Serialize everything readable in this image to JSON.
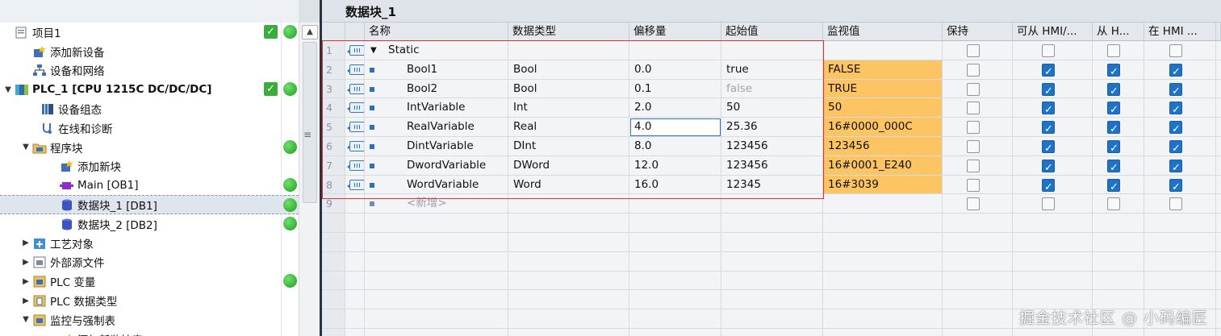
{
  "tree": {
    "items": [
      {
        "label": "项目1",
        "indent": 0,
        "arrow": "",
        "icon": "project-icon",
        "status_check": true,
        "status_dot": true,
        "bold": false,
        "selected": false
      },
      {
        "label": "添加新设备",
        "indent": 1,
        "arrow": "",
        "icon": "add-device-icon",
        "status_check": false,
        "status_dot": false,
        "bold": false,
        "selected": false
      },
      {
        "label": "设备和网络",
        "indent": 1,
        "arrow": "",
        "icon": "network-icon",
        "status_check": false,
        "status_dot": false,
        "bold": false,
        "selected": false
      },
      {
        "label": "PLC_1 [CPU 1215C DC/DC/DC]",
        "indent": 0,
        "arrow": "▼",
        "icon": "plc-icon",
        "status_check": true,
        "status_dot": true,
        "bold": true,
        "selected": false
      },
      {
        "label": "设备组态",
        "indent": 2,
        "arrow": "",
        "icon": "device-config-icon",
        "status_check": false,
        "status_dot": false,
        "bold": false,
        "selected": false
      },
      {
        "label": "在线和诊断",
        "indent": 2,
        "arrow": "",
        "icon": "diagnostics-icon",
        "status_check": false,
        "status_dot": false,
        "bold": false,
        "selected": false
      },
      {
        "label": "程序块",
        "indent": 1,
        "arrow": "▼",
        "icon": "folder-icon",
        "status_check": false,
        "status_dot": true,
        "bold": false,
        "selected": false
      },
      {
        "label": "添加新块",
        "indent": 3,
        "arrow": "",
        "icon": "add-block-icon",
        "status_check": false,
        "status_dot": false,
        "bold": false,
        "selected": false
      },
      {
        "label": "Main [OB1]",
        "indent": 3,
        "arrow": "",
        "icon": "ob-block-icon",
        "status_check": false,
        "status_dot": true,
        "bold": false,
        "selected": false
      },
      {
        "label": "数据块_1 [DB1]",
        "indent": 3,
        "arrow": "",
        "icon": "db-block-icon",
        "status_check": false,
        "status_dot": true,
        "bold": false,
        "selected": true
      },
      {
        "label": "数据块_2 [DB2]",
        "indent": 3,
        "arrow": "",
        "icon": "db-block-icon",
        "status_check": false,
        "status_dot": true,
        "bold": false,
        "selected": false
      },
      {
        "label": "工艺对象",
        "indent": 1,
        "arrow": "▶",
        "icon": "technology-object-icon",
        "status_check": false,
        "status_dot": false,
        "bold": false,
        "selected": false
      },
      {
        "label": "外部源文件",
        "indent": 1,
        "arrow": "▶",
        "icon": "external-source-icon",
        "status_check": false,
        "status_dot": false,
        "bold": false,
        "selected": false
      },
      {
        "label": "PLC 变量",
        "indent": 1,
        "arrow": "▶",
        "icon": "plc-tags-icon",
        "status_check": false,
        "status_dot": true,
        "bold": false,
        "selected": false
      },
      {
        "label": "PLC 数据类型",
        "indent": 1,
        "arrow": "▶",
        "icon": "plc-datatype-icon",
        "status_check": false,
        "status_dot": false,
        "bold": false,
        "selected": false
      },
      {
        "label": "监控与强制表",
        "indent": 1,
        "arrow": "▼",
        "icon": "watch-table-icon",
        "status_check": false,
        "status_dot": false,
        "bold": false,
        "selected": false
      },
      {
        "label": "添加新监控表",
        "indent": 3,
        "arrow": "",
        "icon": "add-watch-table-icon",
        "status_check": false,
        "status_dot": false,
        "bold": false,
        "selected": false
      }
    ]
  },
  "editor": {
    "title": "数据块_1",
    "columns": {
      "name": "名称",
      "datatype": "数据类型",
      "offset": "偏移量",
      "start": "起始值",
      "monitor": "监视值",
      "retain": "保持",
      "hmi_access": "可从 HMI/...",
      "hmi_write": "从 H...",
      "hmi_visible": "在 HMI ..."
    },
    "rows": [
      {
        "num": "1",
        "name": "Static",
        "type": "",
        "offset": "",
        "start": "",
        "monitor": "",
        "is_group": true,
        "retain": false,
        "hmi_access": false,
        "hmi_write": false,
        "hmi_visible": false
      },
      {
        "num": "2",
        "name": "Bool1",
        "type": "Bool",
        "offset": "0.0",
        "start": "true",
        "monitor": "FALSE",
        "is_group": false,
        "retain": false,
        "hmi_access": true,
        "hmi_write": true,
        "hmi_visible": true
      },
      {
        "num": "3",
        "name": "Bool2",
        "type": "Bool",
        "offset": "0.1",
        "start": "false",
        "monitor": "TRUE",
        "is_group": false,
        "retain": false,
        "hmi_access": true,
        "hmi_write": true,
        "hmi_visible": true,
        "start_gray": true
      },
      {
        "num": "4",
        "name": "IntVariable",
        "type": "Int",
        "offset": "2.0",
        "start": "50",
        "monitor": "50",
        "is_group": false,
        "retain": false,
        "hmi_access": true,
        "hmi_write": true,
        "hmi_visible": true
      },
      {
        "num": "5",
        "name": "RealVariable",
        "type": "Real",
        "offset": "4.0",
        "start": "25.36",
        "monitor": "16#0000_000C",
        "is_group": false,
        "retain": false,
        "hmi_access": true,
        "hmi_write": true,
        "hmi_visible": true,
        "focused": true
      },
      {
        "num": "6",
        "name": "DintVariable",
        "type": "DInt",
        "offset": "8.0",
        "start": "123456",
        "monitor": "123456",
        "is_group": false,
        "retain": false,
        "hmi_access": true,
        "hmi_write": true,
        "hmi_visible": true
      },
      {
        "num": "7",
        "name": "DwordVariable",
        "type": "DWord",
        "offset": "12.0",
        "start": "123456",
        "monitor": "16#0001_E240",
        "is_group": false,
        "retain": false,
        "hmi_access": true,
        "hmi_write": true,
        "hmi_visible": true
      },
      {
        "num": "8",
        "name": "WordVariable",
        "type": "Word",
        "offset": "16.0",
        "start": "12345",
        "monitor": "16#3039",
        "is_group": false,
        "retain": false,
        "hmi_access": true,
        "hmi_write": true,
        "hmi_visible": true
      },
      {
        "num": "9",
        "name": "<新增>",
        "type": "",
        "offset": "",
        "start": "",
        "monitor": "",
        "is_group": false,
        "is_new": true,
        "retain": false,
        "hmi_access": false,
        "hmi_write": false,
        "hmi_visible": false
      }
    ]
  },
  "watermark": "掘金技术社区 @ 小码编匠",
  "colors": {
    "monitor_bg": "#fdc463",
    "status_green": "#3bab3b",
    "checkbox_blue": "#1e73c9",
    "highlight_frame": "#e0303a"
  }
}
